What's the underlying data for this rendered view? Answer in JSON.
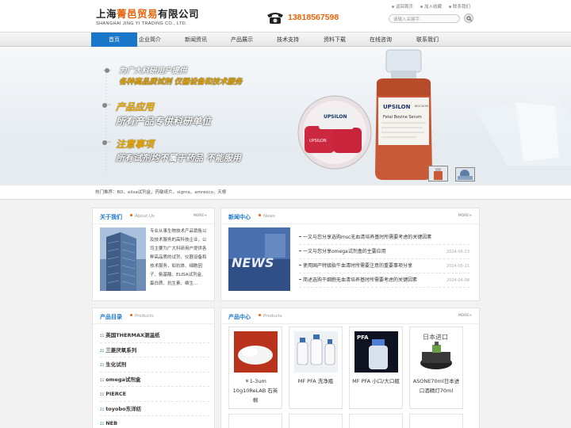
{
  "header": {
    "company_name_a": "上海",
    "company_name_b": "菁邑贸易",
    "company_name_c": "有限公司",
    "company_name_en": "SHANGHAI JING YI TRADING CO., LTD.",
    "phone": "13818567598",
    "links": [
      "返回首页",
      "加入收藏",
      "联系我们"
    ],
    "search_placeholder": "请输入关键字"
  },
  "nav": {
    "items": [
      "首页",
      "企业简介",
      "新闻资讯",
      "产品展示",
      "技术支持",
      "资料下载",
      "在线咨询",
      "联系我们"
    ],
    "active_index": 0
  },
  "banner": {
    "line1": "为广大科研用户提供",
    "line2": "各种高品质试剂 仪器设备和技术服务",
    "line3": "产品应用",
    "line4": "所有产品专供科研单位",
    "line5": "注意事项",
    "line6": "所有试剂均不属于药品 不能服用",
    "bottle_brand": "UPSILON",
    "bottle_label": "Fetal Bovine Serum",
    "dish_brand": "UPSILON",
    "bottle_maker": "BIOCDOM"
  },
  "hot": {
    "text": "热门推荐：BD，elisa试剂盒，药敏纸片，sigma，amresco，天根"
  },
  "about": {
    "title": "关于我们",
    "subtitle": "About Us",
    "more": "MORE+",
    "text": "专业从事生物技术产品销售以及技术服务的高科技企业，公司主要为广大科研用户提供各种高品质的试剂、仪器设备和技术服务，如抗体、细胞因子、氨基酸、ELISA试剂盒、蛋白质、抗生素、维生..."
  },
  "news": {
    "title": "新闻中心",
    "subtitle": "News",
    "more": "MORE+",
    "image_text": "NEWS",
    "items": [
      {
        "title": "一文与您分享选购msc无血清培养基时所需要考虑的关键因素",
        "date": ""
      },
      {
        "title": "一文与您分享omega试剂盒的主要应用",
        "date": "2024-06-13"
      },
      {
        "title": "使用国产特级胎牛血清时所需要注意的重要事项分享",
        "date": "2024-05-11"
      },
      {
        "title": "简述选购干细胞无血清培养基时所需要考虑的关键因素",
        "date": "2024-04-08"
      }
    ]
  },
  "categories": {
    "title": "产品目录",
    "subtitle": "Products",
    "items": [
      "英国THERMAX测温纸",
      "三菱厌氧系列",
      "生化试剂",
      "omega试剂盒",
      "PIERCE",
      "toyobo东洋纺",
      "NEB"
    ]
  },
  "products": {
    "title": "产品中心",
    "subtitle": "Products",
    "more": "MORE+",
    "items": [
      {
        "name": "＊1-3um 10g10ReLAB 石英棉"
      },
      {
        "name": "MF PFA 洗净瓶"
      },
      {
        "name": "MF PFA 小口/大口瓶"
      },
      {
        "name": "ASONE70ml日本进口酒精灯70ml"
      }
    ],
    "img3_label": "PFA",
    "img4_label": "日本进口"
  }
}
